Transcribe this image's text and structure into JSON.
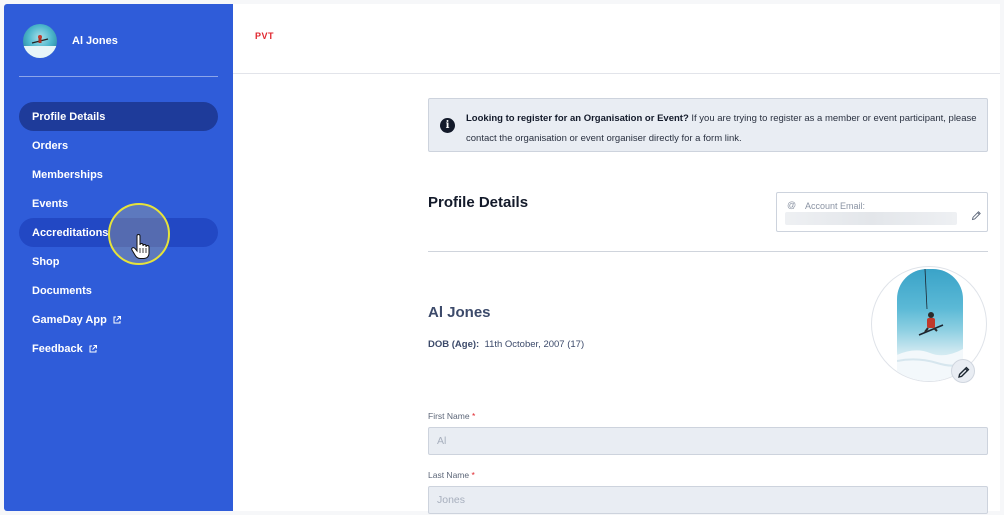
{
  "user": {
    "name": "Al Jones"
  },
  "brand": {
    "logo_text": "PVT",
    "accent": "#2f5cd9",
    "active": "#1e3b9a",
    "logo_color": "#e0262e"
  },
  "sidebar": {
    "items": [
      {
        "label": "Profile Details",
        "state": "active"
      },
      {
        "label": "Orders",
        "state": ""
      },
      {
        "label": "Memberships",
        "state": ""
      },
      {
        "label": "Events",
        "state": ""
      },
      {
        "label": "Accreditations",
        "state": "hover"
      },
      {
        "label": "Shop",
        "state": ""
      },
      {
        "label": "Documents",
        "state": ""
      },
      {
        "label": "GameDay App",
        "state": "",
        "icon": "external-link-icon"
      },
      {
        "label": "Feedback",
        "state": "",
        "icon": "external-link-icon"
      }
    ]
  },
  "notice": {
    "bold": "Looking to register for an Organisation or Event?",
    "text": " If you are trying to register as a member or event participant, please contact the organisation or event organiser directly for a form link."
  },
  "profile": {
    "section_title": "Profile Details",
    "email_label": "Account Email:",
    "full_name": "Al Jones",
    "dob_label": "DOB (Age):",
    "dob_value": "11th October, 2007 (17)"
  },
  "form": {
    "first_name_label": "First Name",
    "first_name_value": "Al",
    "last_name_label": "Last Name",
    "last_name_value": "Jones",
    "required_mark": "*"
  }
}
